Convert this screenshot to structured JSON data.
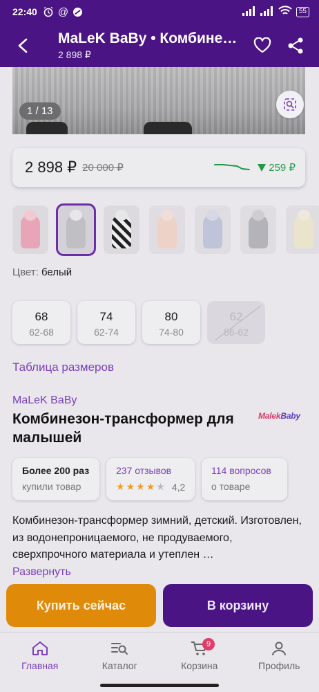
{
  "status_bar": {
    "time": "22:40",
    "battery": "55"
  },
  "header": {
    "title": "MaLeK BaBy • Комбинезон-трансформер",
    "subtitle": "2 898 ₽"
  },
  "gallery": {
    "counter": "1 / 13"
  },
  "price": {
    "current": "2 898 ₽",
    "old": "20 000 ₽",
    "drop": "259 ₽",
    "drop_color": "#1d9b47"
  },
  "color": {
    "label": "Цвет:",
    "value": "белый"
  },
  "sizes": [
    {
      "size": "68",
      "range": "62-68",
      "available": true
    },
    {
      "size": "74",
      "range": "62-74",
      "available": true
    },
    {
      "size": "80",
      "range": "74-80",
      "available": true
    },
    {
      "size": "62",
      "range": "56-62",
      "available": false
    }
  ],
  "size_table_link": "Таблица размеров",
  "product": {
    "brand": "MaLeK BaBy",
    "title": "Комбинезон-трансформер для малышей",
    "brand_logo": {
      "part1": "Malek",
      "part2": "Baby"
    }
  },
  "stats": {
    "purchases": {
      "title": "Более 200 раз",
      "sub": "купили товар"
    },
    "reviews": {
      "title": "237 отзывов",
      "rating": "4,2",
      "stars": 4
    },
    "questions": {
      "title": "114 вопросов",
      "sub": "о товаре"
    }
  },
  "description": "Комбинезон-трансформер зимний, детский. Изготовлен, из водонепроницаемого, не продуваемого, сверхпрочного материала и утеплен …",
  "expand_link": "Развернуть",
  "actions": {
    "buy_now": "Купить сейчас",
    "add_to_cart": "В корзину"
  },
  "nav": {
    "home": "Главная",
    "catalog": "Каталог",
    "cart": "Корзина",
    "cart_badge": "9",
    "profile": "Профиль"
  },
  "colors": {
    "brand_purple": "#4b1484",
    "accent_purple": "#7a3fb8",
    "buy_orange": "#e08a0a"
  }
}
